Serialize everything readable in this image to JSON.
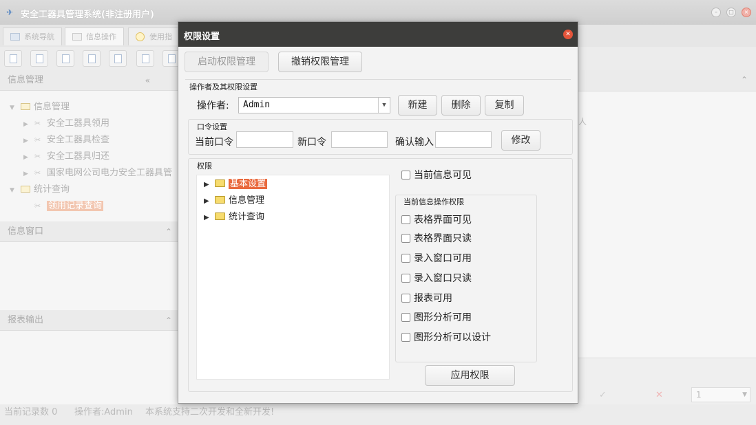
{
  "main": {
    "window_title": "安全工器具管理系统(非注册用户)",
    "tabs": [
      {
        "label": "系统导航"
      },
      {
        "label": "信息操作"
      },
      {
        "label": "使用指"
      }
    ],
    "left_panel": {
      "info_header": "信息管理",
      "tree": [
        {
          "label": "信息管理",
          "level": 0,
          "expanded": true
        },
        {
          "label": "安全工器具领用",
          "level": 1
        },
        {
          "label": "安全工器具检查",
          "level": 1
        },
        {
          "label": "安全工器具归还",
          "level": 1
        },
        {
          "label": "国家电网公司电力安全工器具管",
          "level": 1
        },
        {
          "label": "统计查询",
          "level": 0,
          "expanded": true
        },
        {
          "label": "领用记录查询",
          "level": 1,
          "selected": true
        }
      ],
      "info_window_header": "信息窗口",
      "report_header": "报表输出"
    },
    "right_area": {
      "column_text": "人",
      "page_value": "1"
    },
    "status_bar": {
      "record_count": "当前记录数 0",
      "operator": "操作者:Admin",
      "slogan": "本系统支持二次开发和全新开发!"
    }
  },
  "dialog": {
    "title": "权限设置",
    "top_buttons": {
      "enable": "启动权限管理",
      "revoke": "撤销权限管理"
    },
    "operator_group": {
      "label": "操作者及其权限设置",
      "operator_label": "操作者:",
      "operator_value": "Admin",
      "new_button": "新建",
      "delete_button": "删除",
      "copy_button": "复制"
    },
    "password_group": {
      "label": "口令设置",
      "current_label": "当前口令",
      "new_label": "新口令",
      "confirm_label": "确认输入",
      "modify_button": "修改"
    },
    "permission_group": {
      "label": "权限",
      "tree": [
        {
          "label": "基本设置",
          "selected": true
        },
        {
          "label": "信息管理"
        },
        {
          "label": "统计查询"
        }
      ],
      "current_info_visible": "当前信息可见",
      "ops_group_label": "当前信息操作权限",
      "ops": [
        {
          "label": "表格界面可见",
          "checked": false
        },
        {
          "label": "表格界面只读",
          "checked": false
        },
        {
          "label": "录入窗口可用",
          "checked": false
        },
        {
          "label": "录入窗口只读",
          "checked": false
        },
        {
          "label": "报表可用",
          "checked": false
        },
        {
          "label": "图形分析可用",
          "checked": false
        },
        {
          "label": "图形分析可以设计",
          "checked": false
        }
      ],
      "apply_button": "应用权限"
    }
  }
}
